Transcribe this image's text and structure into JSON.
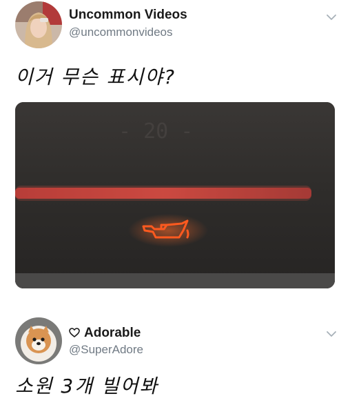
{
  "tweets": [
    {
      "author": {
        "name": "Uncommon Videos",
        "handle": "@uncommonvideos"
      },
      "text": "이거 무슨 표시야?",
      "media": {
        "description_icon": "oil-pressure-warning-icon"
      }
    },
    {
      "author": {
        "name": "Adorable",
        "handle": "@SuperAdore",
        "name_icon": "heart-outline-icon"
      },
      "text": "소원 3개 빌어봐"
    }
  ],
  "colors": {
    "name": "#1a1a1a",
    "handle": "#707a84",
    "warning_light": "#ff5a1f",
    "dashboard_bg": "#2d2b29"
  }
}
